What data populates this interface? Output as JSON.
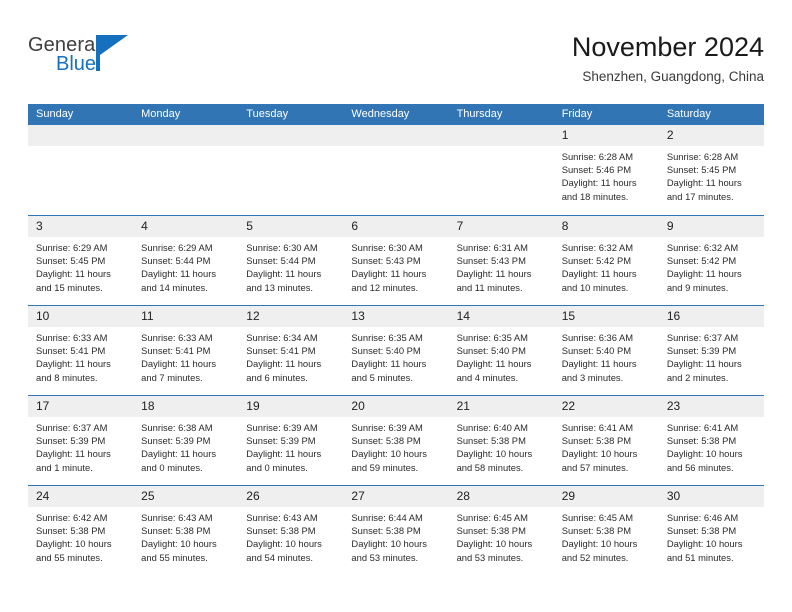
{
  "logo": {
    "text_top": "General",
    "text_bottom": "Blue",
    "accent_color": "#1670c0"
  },
  "header": {
    "title": "November 2024",
    "subtitle": "Shenzhen, Guangdong, China",
    "header_bg_color": "#3175b5",
    "daynum_bg_color": "#efefef"
  },
  "weekdays": [
    "Sunday",
    "Monday",
    "Tuesday",
    "Wednesday",
    "Thursday",
    "Friday",
    "Saturday"
  ],
  "weeks": [
    [
      {
        "day": "",
        "empty": true
      },
      {
        "day": "",
        "empty": true
      },
      {
        "day": "",
        "empty": true
      },
      {
        "day": "",
        "empty": true
      },
      {
        "day": "",
        "empty": true
      },
      {
        "day": "1",
        "sunrise": "Sunrise: 6:28 AM",
        "sunset": "Sunset: 5:46 PM",
        "daylight": "Daylight: 11 hours and 18 minutes."
      },
      {
        "day": "2",
        "sunrise": "Sunrise: 6:28 AM",
        "sunset": "Sunset: 5:45 PM",
        "daylight": "Daylight: 11 hours and 17 minutes."
      }
    ],
    [
      {
        "day": "3",
        "sunrise": "Sunrise: 6:29 AM",
        "sunset": "Sunset: 5:45 PM",
        "daylight": "Daylight: 11 hours and 15 minutes."
      },
      {
        "day": "4",
        "sunrise": "Sunrise: 6:29 AM",
        "sunset": "Sunset: 5:44 PM",
        "daylight": "Daylight: 11 hours and 14 minutes."
      },
      {
        "day": "5",
        "sunrise": "Sunrise: 6:30 AM",
        "sunset": "Sunset: 5:44 PM",
        "daylight": "Daylight: 11 hours and 13 minutes."
      },
      {
        "day": "6",
        "sunrise": "Sunrise: 6:30 AM",
        "sunset": "Sunset: 5:43 PM",
        "daylight": "Daylight: 11 hours and 12 minutes."
      },
      {
        "day": "7",
        "sunrise": "Sunrise: 6:31 AM",
        "sunset": "Sunset: 5:43 PM",
        "daylight": "Daylight: 11 hours and 11 minutes."
      },
      {
        "day": "8",
        "sunrise": "Sunrise: 6:32 AM",
        "sunset": "Sunset: 5:42 PM",
        "daylight": "Daylight: 11 hours and 10 minutes."
      },
      {
        "day": "9",
        "sunrise": "Sunrise: 6:32 AM",
        "sunset": "Sunset: 5:42 PM",
        "daylight": "Daylight: 11 hours and 9 minutes."
      }
    ],
    [
      {
        "day": "10",
        "sunrise": "Sunrise: 6:33 AM",
        "sunset": "Sunset: 5:41 PM",
        "daylight": "Daylight: 11 hours and 8 minutes."
      },
      {
        "day": "11",
        "sunrise": "Sunrise: 6:33 AM",
        "sunset": "Sunset: 5:41 PM",
        "daylight": "Daylight: 11 hours and 7 minutes."
      },
      {
        "day": "12",
        "sunrise": "Sunrise: 6:34 AM",
        "sunset": "Sunset: 5:41 PM",
        "daylight": "Daylight: 11 hours and 6 minutes."
      },
      {
        "day": "13",
        "sunrise": "Sunrise: 6:35 AM",
        "sunset": "Sunset: 5:40 PM",
        "daylight": "Daylight: 11 hours and 5 minutes."
      },
      {
        "day": "14",
        "sunrise": "Sunrise: 6:35 AM",
        "sunset": "Sunset: 5:40 PM",
        "daylight": "Daylight: 11 hours and 4 minutes."
      },
      {
        "day": "15",
        "sunrise": "Sunrise: 6:36 AM",
        "sunset": "Sunset: 5:40 PM",
        "daylight": "Daylight: 11 hours and 3 minutes."
      },
      {
        "day": "16",
        "sunrise": "Sunrise: 6:37 AM",
        "sunset": "Sunset: 5:39 PM",
        "daylight": "Daylight: 11 hours and 2 minutes."
      }
    ],
    [
      {
        "day": "17",
        "sunrise": "Sunrise: 6:37 AM",
        "sunset": "Sunset: 5:39 PM",
        "daylight": "Daylight: 11 hours and 1 minute."
      },
      {
        "day": "18",
        "sunrise": "Sunrise: 6:38 AM",
        "sunset": "Sunset: 5:39 PM",
        "daylight": "Daylight: 11 hours and 0 minutes."
      },
      {
        "day": "19",
        "sunrise": "Sunrise: 6:39 AM",
        "sunset": "Sunset: 5:39 PM",
        "daylight": "Daylight: 11 hours and 0 minutes."
      },
      {
        "day": "20",
        "sunrise": "Sunrise: 6:39 AM",
        "sunset": "Sunset: 5:38 PM",
        "daylight": "Daylight: 10 hours and 59 minutes."
      },
      {
        "day": "21",
        "sunrise": "Sunrise: 6:40 AM",
        "sunset": "Sunset: 5:38 PM",
        "daylight": "Daylight: 10 hours and 58 minutes."
      },
      {
        "day": "22",
        "sunrise": "Sunrise: 6:41 AM",
        "sunset": "Sunset: 5:38 PM",
        "daylight": "Daylight: 10 hours and 57 minutes."
      },
      {
        "day": "23",
        "sunrise": "Sunrise: 6:41 AM",
        "sunset": "Sunset: 5:38 PM",
        "daylight": "Daylight: 10 hours and 56 minutes."
      }
    ],
    [
      {
        "day": "24",
        "sunrise": "Sunrise: 6:42 AM",
        "sunset": "Sunset: 5:38 PM",
        "daylight": "Daylight: 10 hours and 55 minutes."
      },
      {
        "day": "25",
        "sunrise": "Sunrise: 6:43 AM",
        "sunset": "Sunset: 5:38 PM",
        "daylight": "Daylight: 10 hours and 55 minutes."
      },
      {
        "day": "26",
        "sunrise": "Sunrise: 6:43 AM",
        "sunset": "Sunset: 5:38 PM",
        "daylight": "Daylight: 10 hours and 54 minutes."
      },
      {
        "day": "27",
        "sunrise": "Sunrise: 6:44 AM",
        "sunset": "Sunset: 5:38 PM",
        "daylight": "Daylight: 10 hours and 53 minutes."
      },
      {
        "day": "28",
        "sunrise": "Sunrise: 6:45 AM",
        "sunset": "Sunset: 5:38 PM",
        "daylight": "Daylight: 10 hours and 53 minutes."
      },
      {
        "day": "29",
        "sunrise": "Sunrise: 6:45 AM",
        "sunset": "Sunset: 5:38 PM",
        "daylight": "Daylight: 10 hours and 52 minutes."
      },
      {
        "day": "30",
        "sunrise": "Sunrise: 6:46 AM",
        "sunset": "Sunset: 5:38 PM",
        "daylight": "Daylight: 10 hours and 51 minutes."
      }
    ]
  ]
}
